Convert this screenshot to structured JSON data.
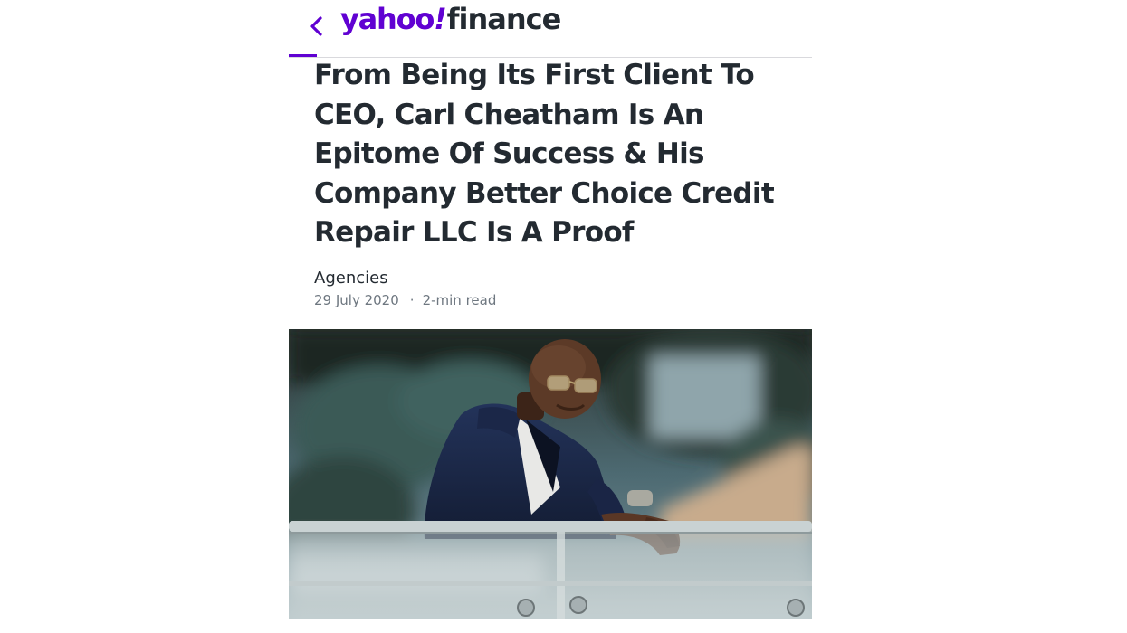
{
  "header": {
    "logo_brand": "yahoo",
    "logo_slash": "!",
    "logo_section": "finance",
    "back_icon": "chevron-left-icon",
    "accent_color": "#6001d2"
  },
  "article": {
    "title": "From Being Its First Client To CEO, Carl Cheatham Is An Epitome Of Success & His Company Better Choice Credit Repair LLC Is A Proof",
    "author": "Agencies",
    "date": "29 July 2020",
    "separator": "·",
    "read_time": "2-min read"
  }
}
